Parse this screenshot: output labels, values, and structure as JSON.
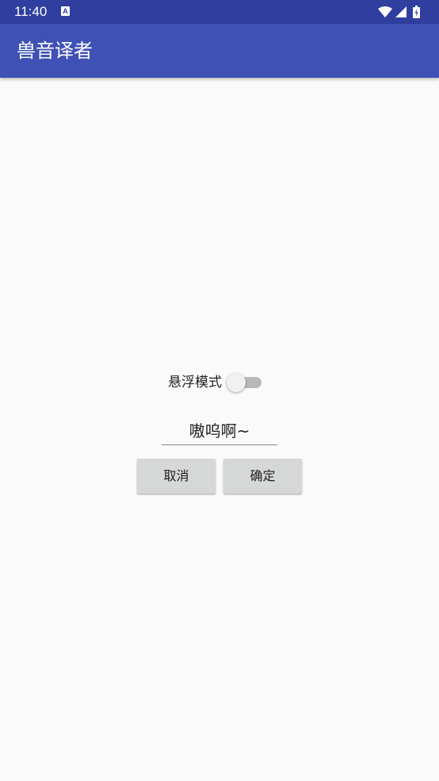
{
  "status_bar": {
    "time": "11:40",
    "notification_icon_letter": "A",
    "icons": [
      "wifi-icon",
      "signal-icon",
      "battery-icon"
    ]
  },
  "app_bar": {
    "title": "兽音译者"
  },
  "float_mode": {
    "label": "悬浮模式",
    "enabled": false
  },
  "input": {
    "value": "嗷呜啊~"
  },
  "buttons": {
    "cancel_label": "取消",
    "ok_label": "确定"
  },
  "colors": {
    "status_bar": "#303f9f",
    "app_bar": "#3f51b5",
    "background": "#fafafa",
    "button": "#d6d7d7"
  }
}
